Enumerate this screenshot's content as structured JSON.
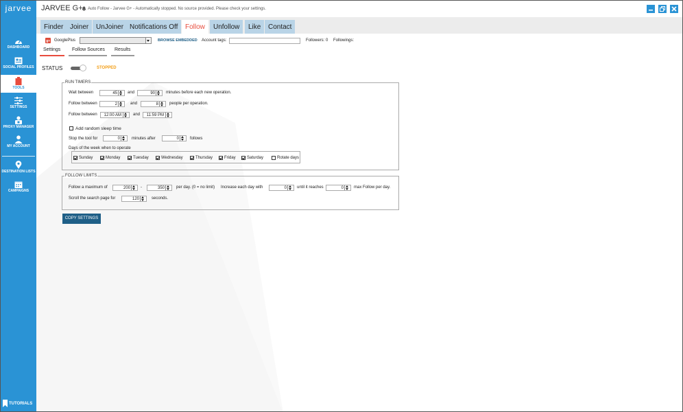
{
  "sidebar": {
    "logo": "jarvee",
    "items": [
      {
        "label": "DASHBOARD",
        "icon": "dashboard-icon"
      },
      {
        "label": "SOCIAL PROFILES",
        "icon": "profiles-icon"
      },
      {
        "label": "TOOLS",
        "icon": "tools-icon"
      },
      {
        "label": "SETTINGS",
        "icon": "settings-icon"
      },
      {
        "label": "PROXY MANAGER",
        "icon": "proxy-icon"
      },
      {
        "label": "MY ACCOUNT",
        "icon": "account-icon"
      },
      {
        "label": "DESTINATION LISTS",
        "icon": "location-icon"
      },
      {
        "label": "CAMPAIGNS",
        "icon": "calendar-icon"
      }
    ],
    "active_item": "TOOLS",
    "tutorials": "TUTORIALS",
    "color": "#2a93d5"
  },
  "titlebar": {
    "title": "JARVEE G+",
    "message": "Auto Follow - Jarvee G+ - Automatically stopped. No source provided. Please check your settings."
  },
  "tabs": [
    {
      "label": "Finder"
    },
    {
      "label": "Joiner"
    },
    {
      "label": "UnJoiner"
    },
    {
      "label": "Notifications Off"
    },
    {
      "label": "Follow"
    },
    {
      "label": "Unfollow"
    },
    {
      "label": "Like"
    },
    {
      "label": "Contact"
    }
  ],
  "active_tab": "Follow",
  "accent_color": "#e84c3d",
  "account": {
    "network": "GooglePlus",
    "selected": "",
    "browse_embedded": "BROWSE EMBEDDED",
    "account_tags_label": "Account tags:",
    "account_tags_value": "",
    "followers_label": "Followers: 0",
    "followings_label": "Followings:"
  },
  "subtabs": [
    {
      "label": "Settings"
    },
    {
      "label": "Follow Sources"
    },
    {
      "label": "Results"
    }
  ],
  "status": {
    "label": "STATUS",
    "value": "STOPPED",
    "value_color": "#f39c12"
  },
  "run_timers": {
    "title": "RUN TIMERS",
    "wait_between_label": "Wait between",
    "wait_min": "45",
    "and1": "and",
    "wait_max": "90",
    "wait_suffix": "minutes before each new operation.",
    "follow_between_label": "Follow between",
    "follow_min": "2",
    "and2": "and",
    "follow_max": "8",
    "follow_suffix": "people per operation.",
    "follow_time_label": "Follow between",
    "time_start": "12:00 AM",
    "and3": "and",
    "time_end": "11:59 PM",
    "random_sleep_label": "Add random sleep time",
    "random_sleep_checked": false,
    "stop_tool_label": "Stop the tool for",
    "stop_minutes": "0",
    "minutes_after": "minutes after",
    "stop_follows": "0",
    "follows_label": "follows",
    "days_label": "Days of the week when to operate",
    "days": [
      {
        "label": "Sunday",
        "checked": true
      },
      {
        "label": "Monday",
        "checked": true
      },
      {
        "label": "Tuesday",
        "checked": true
      },
      {
        "label": "Wednesday",
        "checked": true
      },
      {
        "label": "Thursday",
        "checked": true
      },
      {
        "label": "Friday",
        "checked": true
      },
      {
        "label": "Saturday",
        "checked": true
      }
    ],
    "rotate_days_label": "Rotate days",
    "rotate_days_checked": false
  },
  "follow_limits": {
    "title": "FOLLOW LIMITS",
    "max_label": "Follow a maximum of",
    "max_min": "200",
    "dash": "-",
    "max_max": "350",
    "per_day": "per day. (0 = no limit)",
    "increase_label": "Increase each day with",
    "increase_value": "0",
    "until_label": "until it reaches",
    "until_value": "0",
    "max_per_day": "max Follow per day.",
    "scroll_label": "Scroll the search page for",
    "scroll_value": "120",
    "seconds": "seconds."
  },
  "copy_settings": "COPY SETTINGS"
}
